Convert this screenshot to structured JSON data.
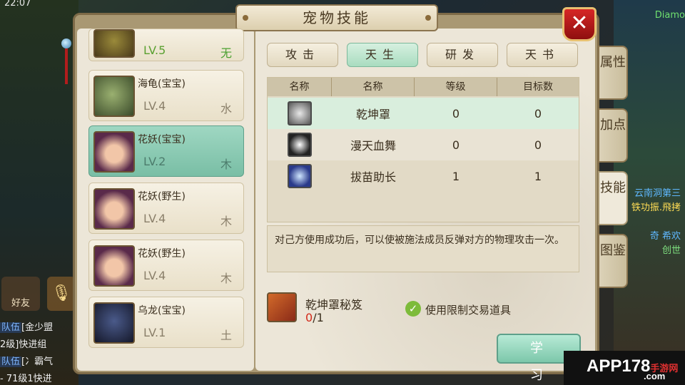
{
  "status": {
    "time": "22:07",
    "currency_label": "Diamo"
  },
  "dialog": {
    "title": "宠物技能",
    "close_label": "✕"
  },
  "pets": [
    {
      "name": "",
      "level": "LV.5",
      "element": "无",
      "selected": false,
      "avatar": "golem-avatar"
    },
    {
      "name": "海龟(宝宝)",
      "level": "LV.4",
      "element": "水",
      "selected": false,
      "avatar": "turtle-avatar"
    },
    {
      "name": "花妖(宝宝)",
      "level": "LV.2",
      "element": "木",
      "selected": true,
      "avatar": "flower-fairy-avatar"
    },
    {
      "name": "花妖(野生)",
      "level": "LV.4",
      "element": "木",
      "selected": false,
      "avatar": "flower-fairy-avatar"
    },
    {
      "name": "花妖(野生)",
      "level": "LV.4",
      "element": "木",
      "selected": false,
      "avatar": "flower-fairy-avatar"
    },
    {
      "name": "乌龙(宝宝)",
      "level": "LV.1",
      "element": "土",
      "selected": false,
      "avatar": "dragon-avatar"
    }
  ],
  "tabs": [
    {
      "label": "攻击",
      "active": false
    },
    {
      "label": "天生",
      "active": true
    },
    {
      "label": "研发",
      "active": false
    },
    {
      "label": "天书",
      "active": false
    }
  ],
  "table": {
    "headers": [
      "名称",
      "名称",
      "等级",
      "目标数"
    ],
    "rows": [
      {
        "icon": "bagua-shield-icon",
        "name": "乾坤罩",
        "level": "0",
        "targets": "0",
        "selected": true
      },
      {
        "icon": "blood-dance-icon",
        "name": "漫天血舞",
        "level": "0",
        "targets": "0",
        "selected": false
      },
      {
        "icon": "sprout-boost-icon",
        "name": "拔苗助长",
        "level": "1",
        "targets": "1",
        "selected": false
      }
    ]
  },
  "description": "对己方使用成功后，可以使被施法成员反弹对方的物理攻击一次。",
  "book": {
    "name": "乾坤罩秘笈",
    "have": "0",
    "need": "/1"
  },
  "restricted_item": {
    "label": "使用限制交易道具",
    "checked": true
  },
  "learn_button": "学习",
  "side_tabs": [
    {
      "label": "属性",
      "active": false
    },
    {
      "label": "加点",
      "active": false
    },
    {
      "label": "技能",
      "active": true
    },
    {
      "label": "图鉴",
      "active": false
    }
  ],
  "hud": {
    "friend_label": "好友",
    "chat": [
      {
        "tag": "队伍",
        "text": "[金少盟"
      },
      {
        "tag": "",
        "text": "2级]快进组"
      },
      {
        "tag": "队伍",
        "text": "[冫霸气"
      },
      {
        "tag": "",
        "text": "- 71级1快进"
      }
    ],
    "right_texts": [
      "云南洞第三",
      "铁功振.飛拷",
      "奇 希欢",
      "创世"
    ]
  },
  "watermark": {
    "brand": "APP178",
    "cn": "手游网",
    "domain": ".com"
  }
}
